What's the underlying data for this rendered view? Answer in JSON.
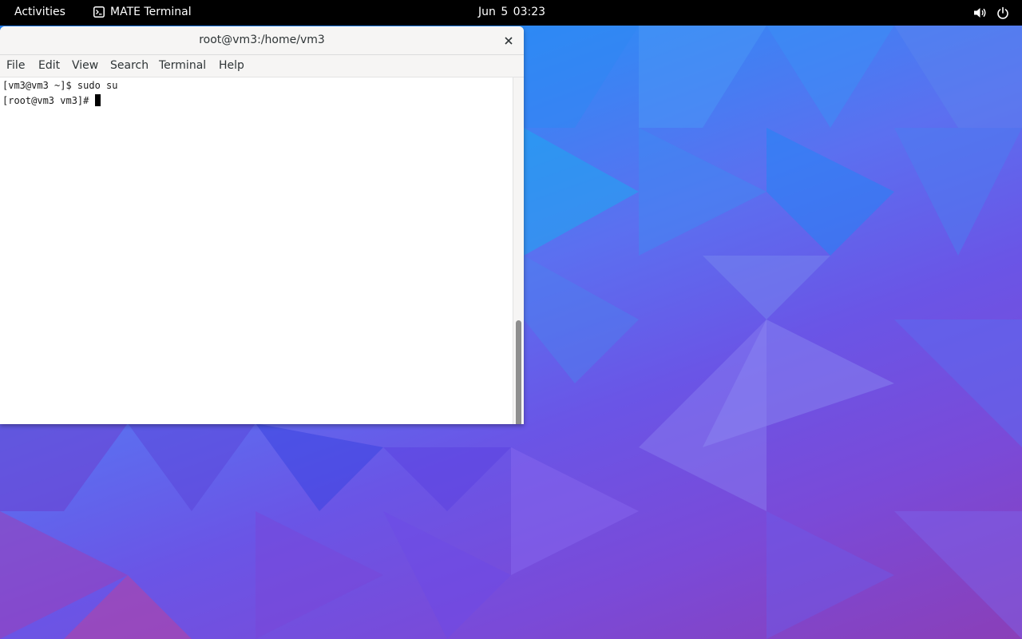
{
  "topbar": {
    "activities": "Activities",
    "app_name": "MATE Terminal",
    "app_icon": "terminal-icon",
    "clock": "Jun 5  03:23",
    "tray_icons": [
      "volume-icon",
      "power-icon"
    ]
  },
  "window": {
    "title": "root@vm3:/home/vm3",
    "close_icon": "close-icon",
    "menu": [
      "File",
      "Edit",
      "View",
      "Search",
      "Terminal",
      "Help"
    ]
  },
  "terminal": {
    "lines": [
      "[vm3@vm3 ~]$ sudo su",
      "[root@vm3 vm3]#"
    ]
  },
  "colors": {
    "topbar_bg": "#000000",
    "window_bg": "#ffffff",
    "titlebar_bg": "#f6f5f4",
    "wallpaper_blue": "#1e7cf0",
    "wallpaper_purple": "#7a4ad8"
  }
}
